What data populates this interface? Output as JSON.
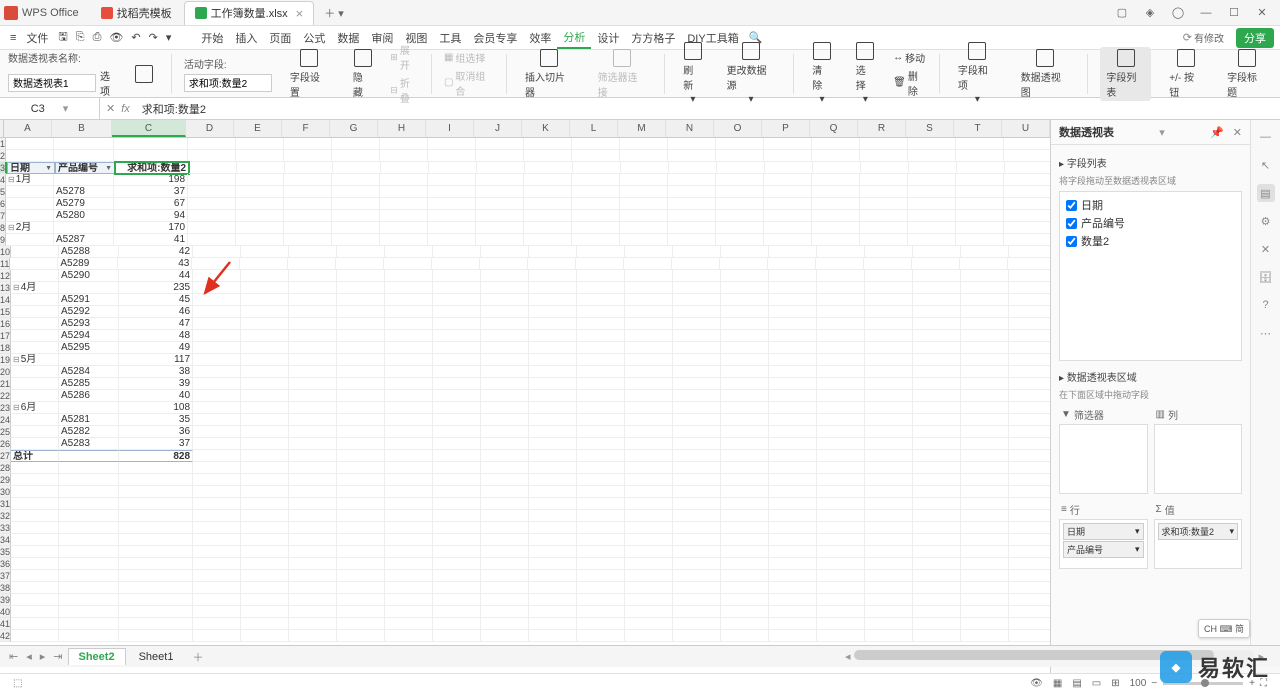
{
  "app": {
    "name": "WPS Office"
  },
  "tabs": [
    {
      "label": "找稻壳模板",
      "type": "pdf"
    },
    {
      "label": "工作簿数量.xlsx",
      "type": "xls",
      "active": true
    }
  ],
  "menu": {
    "file": "文件",
    "items": [
      "开始",
      "插入",
      "页面",
      "公式",
      "数据",
      "审阅",
      "视图",
      "工具",
      "会员专享",
      "效率",
      "分析",
      "设计",
      "方方格子",
      "DIY工具箱"
    ],
    "active": "分析",
    "save_status": "有修改",
    "share": "分享"
  },
  "ribbon": {
    "pivot_name_label": "数据透视表名称:",
    "pivot_name_value": "数据透视表1",
    "options_label": "选项",
    "active_field_label": "活动字段:",
    "active_field_value": "求和项:数量2",
    "field_settings": "字段设置",
    "hide": "隐藏",
    "expand": "展开",
    "collapse": "折叠",
    "group_select": "组选择",
    "ungroup": "取消组合",
    "insert_slicer": "插入切片器",
    "filter_conn": "筛选器连接",
    "refresh": "刷新",
    "change_source": "更改数据源",
    "clear": "清除",
    "select": "选择",
    "move": "移动",
    "delete": "删除",
    "fields_items": "字段和项",
    "pivot_chart": "数据透视图",
    "field_list": "字段列表",
    "plusminus": "+/- 按钮",
    "field_headers": "字段标题"
  },
  "formula": {
    "cell_ref": "C3",
    "content": "求和项:数量2"
  },
  "columns": [
    "A",
    "B",
    "C",
    "D",
    "E",
    "F",
    "G",
    "H",
    "I",
    "J",
    "K",
    "L",
    "M",
    "N",
    "O",
    "P",
    "Q",
    "R",
    "S",
    "T",
    "U"
  ],
  "pivot": {
    "headers": {
      "date": "日期",
      "product": "产品编号",
      "value": "求和项:数量2"
    },
    "groups": [
      {
        "month": "1月",
        "subtotal": 198,
        "rows": [
          [
            "A5278",
            "37"
          ],
          [
            "A5279",
            "67"
          ],
          [
            "A5280",
            "94"
          ]
        ]
      },
      {
        "month": "2月",
        "subtotal": 170,
        "rows": [
          [
            "A5287",
            "41"
          ],
          [
            "A5288",
            "42"
          ],
          [
            "A5289",
            "43"
          ],
          [
            "A5290",
            "44"
          ]
        ]
      },
      {
        "month": "4月",
        "subtotal": 235,
        "rows": [
          [
            "A5291",
            "45"
          ],
          [
            "A5292",
            "46"
          ],
          [
            "A5293",
            "47"
          ],
          [
            "A5294",
            "48"
          ],
          [
            "A5295",
            "49"
          ]
        ]
      },
      {
        "month": "5月",
        "subtotal": 117,
        "rows": [
          [
            "A5284",
            "38"
          ],
          [
            "A5285",
            "39"
          ],
          [
            "A5286",
            "40"
          ]
        ]
      },
      {
        "month": "6月",
        "subtotal": 108,
        "rows": [
          [
            "A5281",
            "35"
          ],
          [
            "A5282",
            "36"
          ],
          [
            "A5283",
            "37"
          ]
        ]
      }
    ],
    "grand_total_label": "总计",
    "grand_total": 828
  },
  "pivotpane": {
    "title": "数据透视表",
    "field_list_title": "字段列表",
    "drag_hint": "将字段拖动至数据透视表区域",
    "fields": [
      {
        "name": "日期",
        "checked": true
      },
      {
        "name": "产品编号",
        "checked": true
      },
      {
        "name": "数量2",
        "checked": true
      }
    ],
    "areas_title": "数据透视表区域",
    "areas_hint": "在下面区域中拖动字段",
    "filters": "筛选器",
    "columns": "列",
    "rows_label": "行",
    "values_label": "值",
    "row_fields": [
      "日期",
      "产品编号"
    ],
    "value_fields": [
      "求和项:数量2"
    ]
  },
  "sheets": {
    "tabs": [
      "Sheet2",
      "Sheet1"
    ],
    "active": "Sheet2"
  },
  "statusbar": {
    "zoom": "100"
  },
  "ime": "CH ⌨ 简",
  "watermark": "易软汇"
}
